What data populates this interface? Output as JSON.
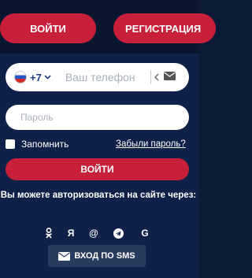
{
  "header": {
    "login_label": "ВОЙТИ",
    "register_label": "РЕГИСТРАЦИЯ"
  },
  "form": {
    "country_code": "+7",
    "phone_placeholder": "Ваш телефон",
    "password_placeholder": "Пароль",
    "remember_label": "Запомнить",
    "forgot_label": "Забыли пароль?",
    "submit_label": "ВОЙТИ"
  },
  "social": {
    "title": "Вы можете авторизоваться на сайте через:",
    "providers": [
      "ok-icon",
      "yandex-icon",
      "mail-ru-icon",
      "telegram-icon",
      "google-icon"
    ],
    "ya_glyph": "Я",
    "at_glyph": "@",
    "g_glyph": "G",
    "sms_label": "ВХОД ПО SMS"
  },
  "colors": {
    "accent": "#c8203a",
    "background": "#0f2148",
    "sms_button": "#2a3b60"
  }
}
